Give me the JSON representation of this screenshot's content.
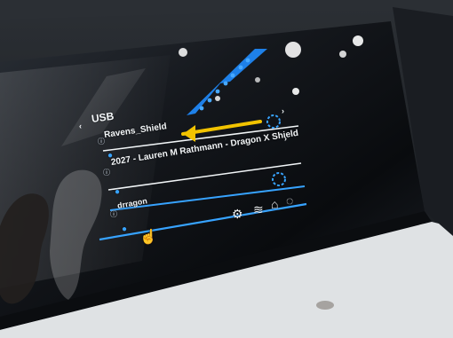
{
  "screen": {
    "breadcrumb": "USB",
    "files": [
      {
        "name": "Ravens_Shield"
      },
      {
        "name": "2027 - Lauren M Rathmann - Dragon X Shield"
      },
      {
        "name": "drragon"
      }
    ]
  },
  "icons": {
    "back": "chevron-left-icon",
    "file_info": "info-icon",
    "droplet": "droplet-icon",
    "loading": "loading-icon",
    "next": "chevron-right-icon",
    "settings": "gear-icon",
    "layers": "layers-icon",
    "home": "home-icon",
    "light": "lightbulb-icon",
    "cursor": "cursor-icon",
    "arrow": "arrow-annotation"
  },
  "colors": {
    "accent_blue": "#37a3ff",
    "annotation_yellow": "#f2c300",
    "screen_dark": "#111316"
  }
}
